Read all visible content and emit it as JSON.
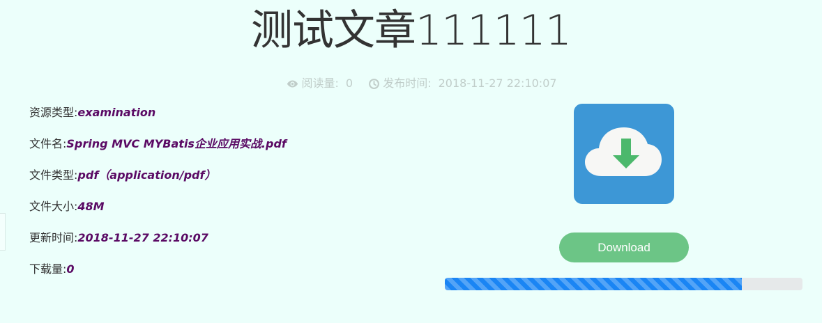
{
  "article": {
    "title": "测试文章111111"
  },
  "meta": {
    "views_label": "阅读量:",
    "views_value": "0",
    "publish_label": "发布时间:",
    "publish_value": "2018-11-27 22:10:07"
  },
  "details": [
    {
      "label": "资源类型:",
      "value": "examination"
    },
    {
      "label": "文件名:",
      "value": "Spring MVC MYBatis企业应用实战.pdf"
    },
    {
      "label": "文件类型:",
      "value": "pdf（application/pdf）"
    },
    {
      "label": "文件大小:",
      "value": "48M"
    },
    {
      "label": "更新时间:",
      "value": "2018-11-27 22:10:07"
    },
    {
      "label": "下载量:",
      "value": "0"
    }
  ],
  "download": {
    "button_label": "Download",
    "icon": "cloud-download-icon",
    "progress_fraction": 0.83
  },
  "colors": {
    "background": "#ecfffb",
    "value_text": "#5a0a64",
    "icon_bg": "#3d97d6",
    "arrow": "#4cb86c",
    "button": "#6cc586",
    "progress": "#1a85f4",
    "progress_track": "#e6e9ea",
    "meta_text": "#c0cdc9"
  }
}
